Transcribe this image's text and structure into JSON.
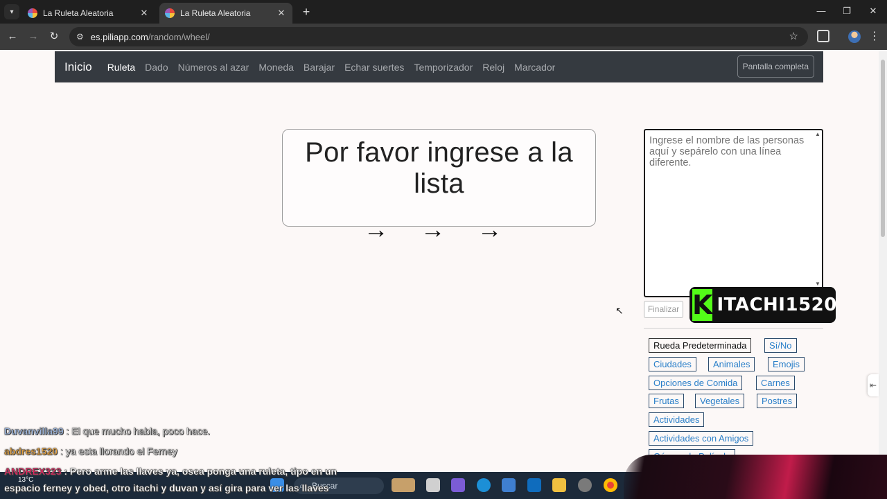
{
  "browser": {
    "tabs": [
      {
        "title": "La Ruleta Aleatoria",
        "active": false
      },
      {
        "title": "La Ruleta Aleatoria",
        "active": true
      }
    ],
    "url_host": "es.piliapp.com",
    "url_path": "/random/wheel/"
  },
  "navbar": {
    "brand": "Inicio",
    "links": [
      "Ruleta",
      "Dado",
      "Números al azar",
      "Moneda",
      "Barajar",
      "Echar suertes",
      "Temporizador",
      "Reloj",
      "Marcador"
    ],
    "active_link": "Ruleta",
    "fullscreen_label": "Pantalla completa"
  },
  "wheel": {
    "message": "Por favor ingrese a la lista",
    "arrows": "→ → →"
  },
  "names_input": {
    "placeholder": "Ingrese el nombre de las personas aquí y sepárelo con una línea diferente."
  },
  "finalize_label": "Finalizar",
  "presets": [
    "Rueda Predeterminada",
    "Sí/No",
    "Ciudades",
    "Animales",
    "Emojis",
    "Opciones de Comida",
    "Carnes",
    "Frutas",
    "Vegetales",
    "Postres",
    "Actividades",
    "Actividades con Amigos",
    "Género de Película"
  ],
  "selected_preset": "Rueda Predeterminada",
  "stream_overlay": {
    "channel": "ITACHI1520",
    "chat": [
      {
        "user": "Duvanvilla99",
        "user_color": "#9db7e0",
        "message": ": El que mucho habla, poco hace."
      },
      {
        "user": "abdres1520",
        "user_color": "#e8a23c",
        "message": ": ya esta llorando el Ferney"
      },
      {
        "user": "ANDREX323",
        "user_color": "#e0245e",
        "message": ": Pero arme las llaves ya, osea ponga una ruleta, tipo en un"
      },
      {
        "user": "",
        "user_color": "#ffffff",
        "message": "espacio ferney y obed, otro itachi y duvan y así gira para ver las llaves"
      }
    ]
  },
  "taskbar": {
    "weather": "13°C",
    "search_placeholder": "Buscar"
  },
  "colors": {
    "navbar_bg": "#353a40",
    "preset_link": "#2a7fc9",
    "kick_green": "#53fc18"
  }
}
